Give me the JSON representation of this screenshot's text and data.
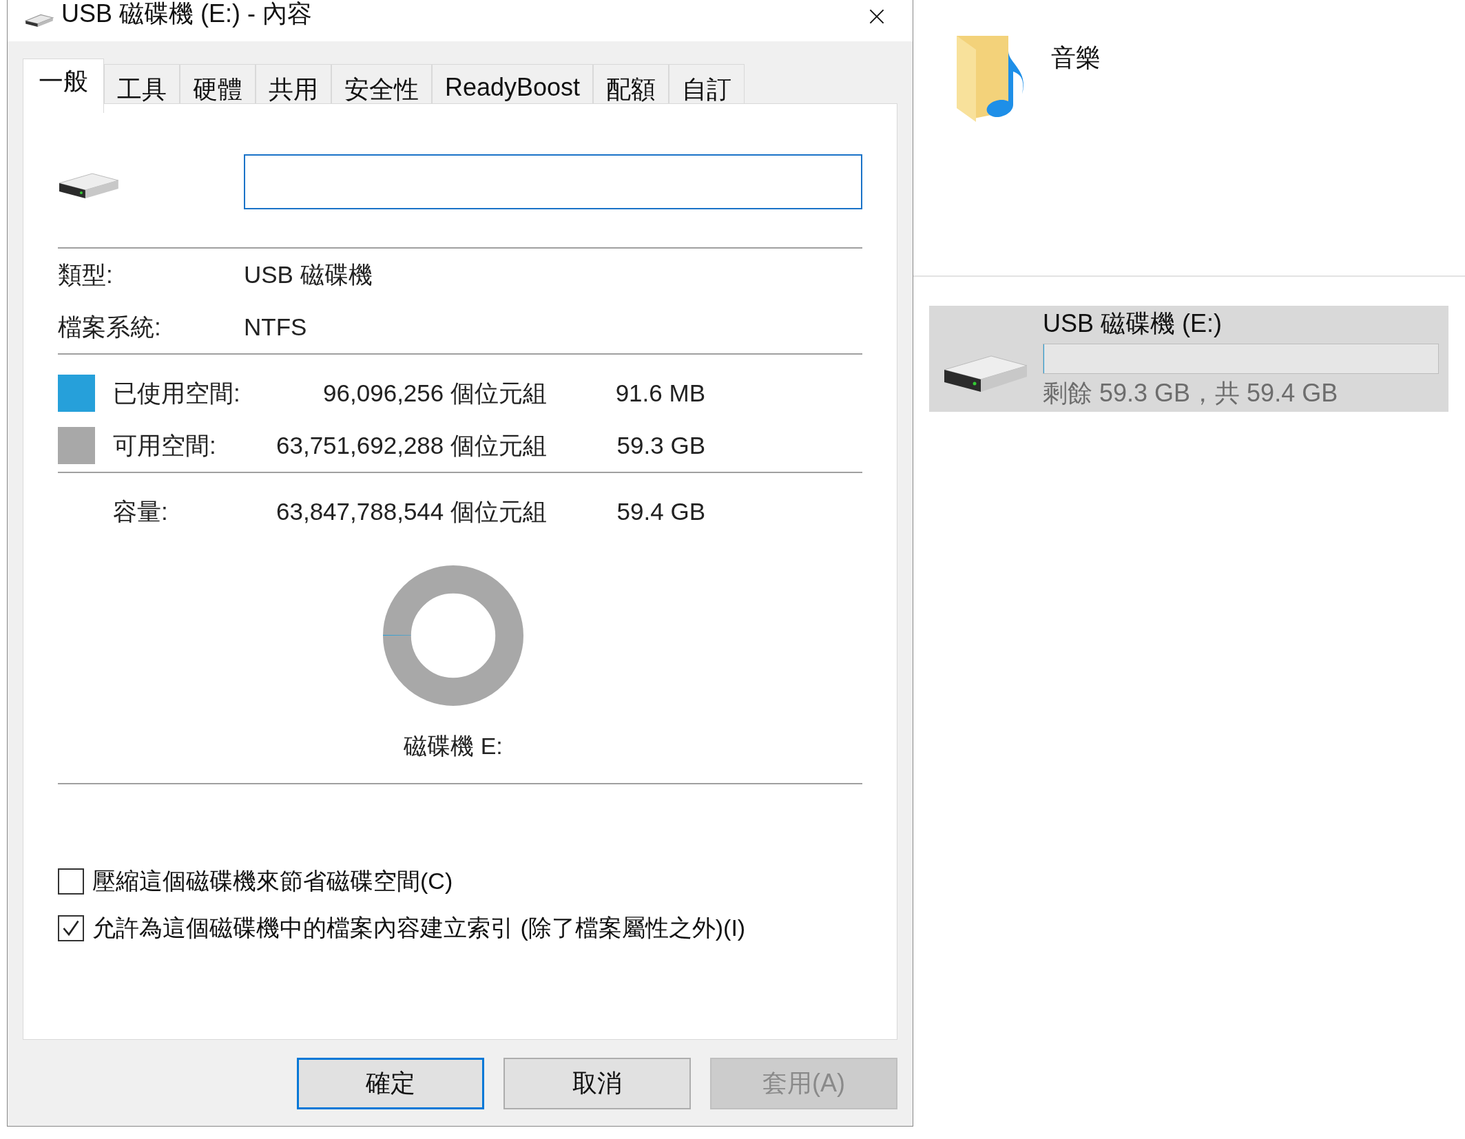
{
  "window": {
    "title": "USB 磁碟機 (E:) - 內容"
  },
  "tabs": [
    {
      "label": "一般",
      "selected": true
    },
    {
      "label": "工具",
      "selected": false
    },
    {
      "label": "硬體",
      "selected": false
    },
    {
      "label": "共用",
      "selected": false
    },
    {
      "label": "安全性",
      "selected": false
    },
    {
      "label": "ReadyBoost",
      "selected": false
    },
    {
      "label": "配額",
      "selected": false
    },
    {
      "label": "自訂",
      "selected": false
    }
  ],
  "info": [
    {
      "label": "類型:",
      "value": "USB 磁碟機"
    },
    {
      "label": "檔案系統:",
      "value": "NTFS"
    }
  ],
  "space": [
    {
      "label": "已使用空間:",
      "bytes": "96,096,256 個位元組",
      "size": "91.6 MB",
      "color": "#26a0da"
    },
    {
      "label": "可用空間:",
      "bytes": "63,751,692,288 個位元組",
      "size": "59.3 GB",
      "color": "#a8a8a8"
    }
  ],
  "capacity": {
    "label": "容量:",
    "bytes": "63,847,788,544 個位元組",
    "size": "59.4 GB"
  },
  "donut": {
    "caption": "磁碟機 E:"
  },
  "options": [
    {
      "label": "壓縮這個磁碟機來節省磁碟空間(C)",
      "checked": false
    },
    {
      "label": "允許為這個磁碟機中的檔案內容建立索引 (除了檔案屬性之外)(I)",
      "checked": true
    }
  ],
  "buttons": [
    {
      "label": "確定",
      "kind": "default",
      "disabled": false
    },
    {
      "label": "取消",
      "kind": "normal",
      "disabled": false
    },
    {
      "label": "套用(A)",
      "kind": "normal",
      "disabled": true
    }
  ],
  "explorer": {
    "folder": {
      "name": "音樂"
    },
    "drive": {
      "name": "USB 磁碟機 (E:)",
      "level": 0.0015,
      "free_text": "剩餘 59.3 GB，共 59.4 GB"
    }
  }
}
